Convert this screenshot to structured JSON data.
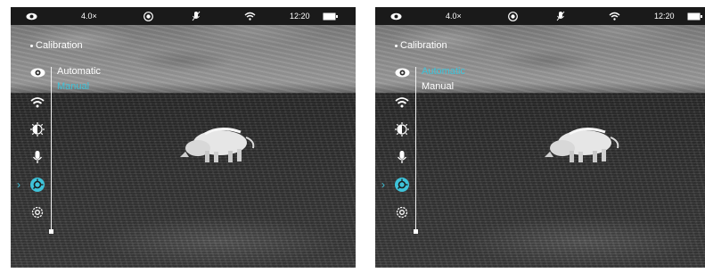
{
  "screens": [
    {
      "id": "left",
      "status": {
        "zoom": "4.0×",
        "time": "12:20"
      },
      "menu_title": "Calibration",
      "options": [
        {
          "label": "Automatic",
          "selected": false
        },
        {
          "label": "Manual",
          "selected": true
        }
      ],
      "active_icon": "calibration-icon"
    },
    {
      "id": "right",
      "status": {
        "zoom": "4.0×",
        "time": "12:20"
      },
      "menu_title": "Calibration",
      "options": [
        {
          "label": "Automatic",
          "selected": true
        },
        {
          "label": "Manual",
          "selected": false
        }
      ],
      "active_icon": "calibration-icon"
    }
  ],
  "status_icons": [
    "eye-icon",
    "camera-icon",
    "mic-off-icon",
    "wifi-icon",
    "battery-icon"
  ],
  "side_icons": [
    "eye-icon",
    "wifi-icon",
    "white-balance-icon",
    "mic-icon",
    "calibration-icon",
    "settings-icon"
  ],
  "colors": {
    "accent": "#3ec3d9",
    "text": "#ffffff",
    "statusbar_bg": "#1a1a1a"
  }
}
